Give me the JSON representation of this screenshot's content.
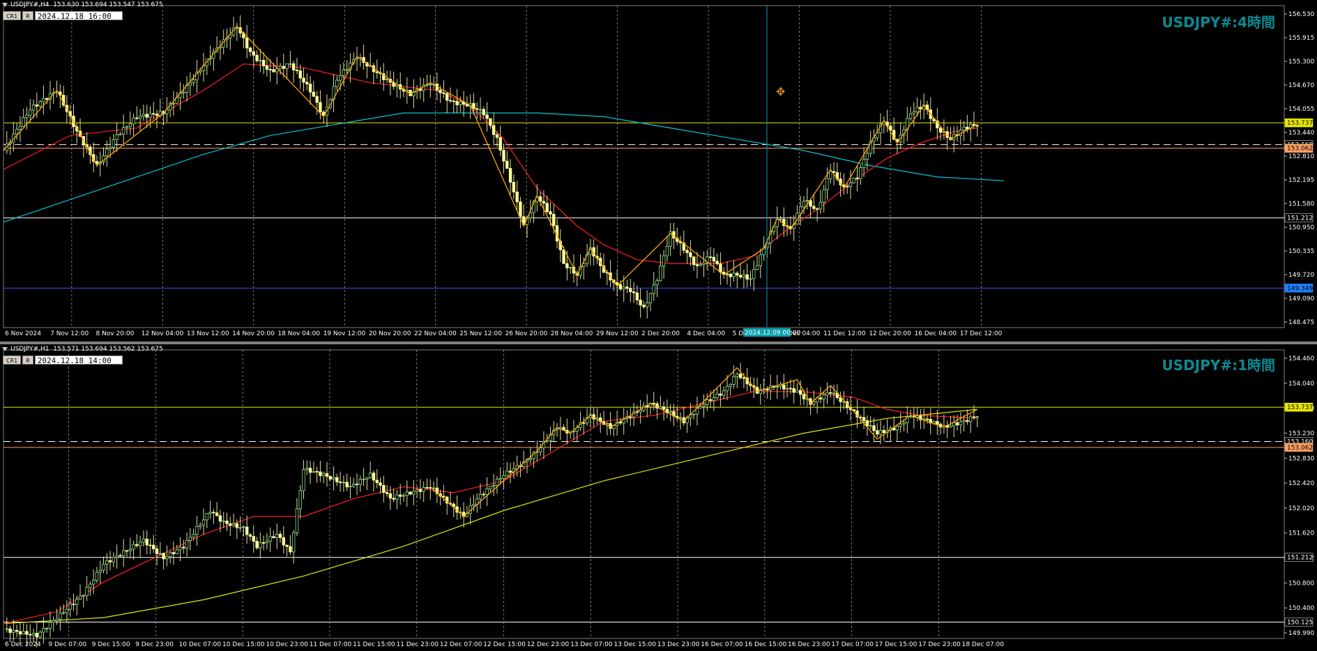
{
  "colors": {
    "bg": "#000000",
    "candle": "#ffff99",
    "zigzag": "#ffa500",
    "ma_red": "#ff2020",
    "ma_cyan": "#00c8d8",
    "ma_yellow": "#e8e800",
    "grid": "#c8c8c8",
    "hline_yellow": "#e8e800",
    "hline_white": "#ffffff",
    "hline_blue": "#3050ff",
    "vline_cursor": "#0aa0b0",
    "title": "#0a8a93"
  },
  "icons": {
    "panel_menu": "triangle-down-icon",
    "tool": "crosshair-tool-icon"
  },
  "chart_data": [
    {
      "type": "candlestick",
      "symbol": "USDJPY#,H4",
      "ohlc_header": "153.630 153.694 153.547 153.675",
      "buttons": [
        "CR1",
        "R"
      ],
      "time_box": "2024.12.18 16:00",
      "title": "USDJPY#:4時間",
      "ylim": [
        148.3,
        156.85
      ],
      "y_ticks": [
        "156.530",
        "155.915",
        "155.300",
        "154.670",
        "154.055",
        "153.440",
        "152.810",
        "152.195",
        "151.580",
        "150.950",
        "150.335",
        "149.720",
        "149.090",
        "148.475"
      ],
      "x_ticks": [
        "6 Nov 2024",
        "7 Nov 12:00",
        "8 Nov 20:00",
        "12 Nov 04:00",
        "13 Nov 12:00",
        "14 Nov 20:00",
        "18 Nov 04:00",
        "19 Nov 12:00",
        "20 Nov 20:00",
        "22 Nov 04:00",
        "25 Nov 12:00",
        "26 Nov 20:00",
        "28 Nov 04:00",
        "29 Nov 12:00",
        "2 Dec 20:00",
        "4 Dec 04:00",
        "5 Dec 1",
        "10 Dec 04:00",
        "11 Dec 12:00",
        "12 Dec 20:00",
        "16 Dec 04:00",
        "17 Dec 12:00"
      ],
      "cursor_label": "2024.12.09 00:00",
      "hlines": [
        {
          "price": 153.737,
          "label": "153.737",
          "style": "solid",
          "color": "#e8e800"
        },
        {
          "price": 153.16,
          "label": "153.160",
          "style": "dashed",
          "color": "#ffffff"
        },
        {
          "price": 153.062,
          "label": "153.062",
          "style": "solid",
          "color": "#ffa060"
        },
        {
          "price": 151.212,
          "label": "151.212",
          "style": "solid",
          "color": "#ffffff"
        },
        {
          "price": 149.349,
          "label": "149.349",
          "style": "solid",
          "color": "#3050ff"
        }
      ],
      "close_path": [
        [
          0,
          153.0
        ],
        [
          8,
          154.1
        ],
        [
          16,
          154.6
        ],
        [
          22,
          153.5
        ],
        [
          28,
          152.6
        ],
        [
          34,
          153.4
        ],
        [
          40,
          153.9
        ],
        [
          48,
          154.0
        ],
        [
          56,
          154.8
        ],
        [
          62,
          155.5
        ],
        [
          70,
          156.3
        ],
        [
          74,
          155.6
        ],
        [
          80,
          155.1
        ],
        [
          86,
          155.3
        ],
        [
          92,
          154.6
        ],
        [
          96,
          153.9
        ],
        [
          100,
          154.9
        ],
        [
          106,
          155.5
        ],
        [
          110,
          155.2
        ],
        [
          116,
          154.8
        ],
        [
          122,
          154.5
        ],
        [
          128,
          154.8
        ],
        [
          134,
          154.3
        ],
        [
          140,
          154.2
        ],
        [
          144,
          154.0
        ],
        [
          148,
          153.3
        ],
        [
          152,
          152.2
        ],
        [
          156,
          151.0
        ],
        [
          160,
          151.8
        ],
        [
          164,
          151.3
        ],
        [
          168,
          150.0
        ],
        [
          172,
          149.7
        ],
        [
          176,
          150.4
        ],
        [
          180,
          149.8
        ],
        [
          184,
          149.4
        ],
        [
          188,
          149.3
        ],
        [
          192,
          148.8
        ],
        [
          196,
          149.6
        ],
        [
          200,
          150.8
        ],
        [
          204,
          150.4
        ],
        [
          208,
          149.9
        ],
        [
          212,
          150.2
        ],
        [
          216,
          149.7
        ],
        [
          220,
          149.7
        ],
        [
          224,
          149.6
        ],
        [
          228,
          150.4
        ],
        [
          232,
          151.2
        ],
        [
          236,
          150.9
        ],
        [
          240,
          151.7
        ],
        [
          244,
          151.4
        ],
        [
          248,
          152.5
        ],
        [
          252,
          152.0
        ],
        [
          256,
          152.3
        ],
        [
          260,
          153.2
        ],
        [
          264,
          153.8
        ],
        [
          268,
          153.2
        ],
        [
          272,
          154.0
        ],
        [
          276,
          154.2
        ],
        [
          280,
          153.6
        ],
        [
          284,
          153.3
        ],
        [
          288,
          153.6
        ],
        [
          292,
          153.7
        ]
      ],
      "zigzag": [
        [
          0,
          153.0
        ],
        [
          16,
          154.6
        ],
        [
          28,
          152.6
        ],
        [
          48,
          154.0
        ],
        [
          70,
          156.3
        ],
        [
          96,
          153.9
        ],
        [
          106,
          155.5
        ],
        [
          122,
          154.5
        ],
        [
          128,
          154.8
        ],
        [
          140,
          154.2
        ],
        [
          156,
          151.0
        ],
        [
          160,
          151.8
        ],
        [
          172,
          149.7
        ],
        [
          176,
          150.4
        ],
        [
          184,
          149.4
        ],
        [
          200,
          150.8
        ],
        [
          216,
          149.7
        ],
        [
          228,
          150.4
        ],
        [
          232,
          151.2
        ],
        [
          236,
          150.9
        ],
        [
          248,
          152.5
        ],
        [
          252,
          152.0
        ],
        [
          264,
          153.8
        ],
        [
          268,
          153.2
        ],
        [
          276,
          154.2
        ],
        [
          284,
          153.3
        ],
        [
          292,
          153.7
        ]
      ],
      "ma_red": [
        [
          0,
          152.5
        ],
        [
          20,
          153.4
        ],
        [
          40,
          153.6
        ],
        [
          60,
          154.6
        ],
        [
          72,
          155.3
        ],
        [
          90,
          155.2
        ],
        [
          110,
          154.8
        ],
        [
          130,
          154.6
        ],
        [
          140,
          154.2
        ],
        [
          150,
          153.3
        ],
        [
          160,
          152.0
        ],
        [
          172,
          151.0
        ],
        [
          180,
          150.5
        ],
        [
          190,
          150.1
        ],
        [
          200,
          150.0
        ],
        [
          215,
          150.0
        ],
        [
          225,
          150.2
        ],
        [
          235,
          150.9
        ],
        [
          245,
          151.5
        ],
        [
          255,
          152.2
        ],
        [
          265,
          152.8
        ],
        [
          275,
          153.2
        ],
        [
          285,
          153.5
        ],
        [
          292,
          153.6
        ]
      ],
      "ma_cyan": [
        [
          0,
          151.1
        ],
        [
          30,
          152.0
        ],
        [
          60,
          152.9
        ],
        [
          80,
          153.4
        ],
        [
          100,
          153.7
        ],
        [
          120,
          154.0
        ],
        [
          140,
          154.0
        ],
        [
          160,
          154.0
        ],
        [
          180,
          153.9
        ],
        [
          200,
          153.6
        ],
        [
          220,
          153.3
        ],
        [
          240,
          153.0
        ],
        [
          260,
          152.6
        ],
        [
          280,
          152.3
        ],
        [
          300,
          152.2
        ]
      ]
    },
    {
      "type": "candlestick",
      "symbol": "USDJPY#,H1",
      "ohlc_header": "153.571 153.694 153.562 153.675",
      "buttons": [
        "CR1",
        "R"
      ],
      "time_box": "2024.12.18 14:00",
      "title": "USDJPY#:1時間",
      "ylim": [
        149.85,
        154.7
      ],
      "y_ticks": [
        "154.460",
        "154.040",
        "153.630",
        "153.230",
        "152.830",
        "152.420",
        "152.020",
        "151.620",
        "151.212",
        "150.800",
        "150.400",
        "149.990"
      ],
      "x_ticks": [
        "6 Dec 2024",
        "9 Dec 07:00",
        "9 Dec 15:00",
        "9 Dec 23:00",
        "10 Dec 07:00",
        "10 Dec 15:00",
        "10 Dec 23:00",
        "11 Dec 07:00",
        "11 Dec 15:00",
        "11 Dec 23:00",
        "12 Dec 07:00",
        "12 Dec 15:00",
        "12 Dec 23:00",
        "13 Dec 07:00",
        "13 Dec 15:00",
        "13 Dec 23:00",
        "16 Dec 07:00",
        "16 Dec 15:00",
        "16 Dec 23:00",
        "17 Dec 07:00",
        "17 Dec 15:00",
        "17 Dec 23:00",
        "18 Dec 07:00"
      ],
      "hlines": [
        {
          "price": 153.737,
          "label": "153.737",
          "style": "solid",
          "color": "#e8e800"
        },
        {
          "price": 153.16,
          "label": "153.160",
          "style": "dashed",
          "color": "#ffffff"
        },
        {
          "price": 153.062,
          "label": "153.062",
          "style": "solid",
          "color": "#ffa060"
        },
        {
          "price": 151.212,
          "label": "151.212",
          "style": "solid",
          "color": "#ffffff"
        },
        {
          "price": 150.125,
          "label": "150.125",
          "style": "solid",
          "color": "#ffffff"
        }
      ],
      "close_path": [
        [
          0,
          150.0
        ],
        [
          10,
          149.9
        ],
        [
          16,
          150.2
        ],
        [
          24,
          150.6
        ],
        [
          30,
          151.1
        ],
        [
          36,
          151.3
        ],
        [
          42,
          151.5
        ],
        [
          48,
          151.2
        ],
        [
          54,
          151.4
        ],
        [
          58,
          151.7
        ],
        [
          62,
          152.0
        ],
        [
          66,
          151.8
        ],
        [
          72,
          151.7
        ],
        [
          76,
          151.4
        ],
        [
          82,
          151.6
        ],
        [
          86,
          151.3
        ],
        [
          90,
          152.7
        ],
        [
          96,
          152.6
        ],
        [
          104,
          152.4
        ],
        [
          110,
          152.6
        ],
        [
          116,
          152.2
        ],
        [
          122,
          152.3
        ],
        [
          128,
          152.4
        ],
        [
          132,
          152.2
        ],
        [
          138,
          151.9
        ],
        [
          142,
          152.2
        ],
        [
          146,
          152.4
        ],
        [
          150,
          152.6
        ],
        [
          156,
          152.8
        ],
        [
          160,
          153.0
        ],
        [
          166,
          153.4
        ],
        [
          170,
          153.3
        ],
        [
          176,
          153.6
        ],
        [
          182,
          153.4
        ],
        [
          188,
          153.6
        ],
        [
          194,
          153.8
        ],
        [
          198,
          153.7
        ],
        [
          204,
          153.5
        ],
        [
          210,
          153.8
        ],
        [
          216,
          154.0
        ],
        [
          220,
          154.3
        ],
        [
          226,
          154.0
        ],
        [
          232,
          154.1
        ],
        [
          238,
          154.0
        ],
        [
          242,
          153.8
        ],
        [
          248,
          154.0
        ],
        [
          254,
          153.7
        ],
        [
          258,
          153.5
        ],
        [
          262,
          153.3
        ],
        [
          268,
          153.4
        ],
        [
          272,
          153.6
        ],
        [
          278,
          153.5
        ],
        [
          282,
          153.4
        ],
        [
          288,
          153.5
        ],
        [
          292,
          153.6
        ]
      ],
      "zigzag": [
        [
          128,
          152.4
        ],
        [
          138,
          151.9
        ],
        [
          160,
          153.0
        ],
        [
          166,
          153.4
        ],
        [
          170,
          153.3
        ],
        [
          176,
          153.6
        ],
        [
          182,
          153.4
        ],
        [
          194,
          153.8
        ],
        [
          204,
          153.5
        ],
        [
          220,
          154.4
        ],
        [
          226,
          154.0
        ],
        [
          238,
          154.2
        ],
        [
          242,
          153.8
        ],
        [
          248,
          154.1
        ],
        [
          256,
          153.6
        ],
        [
          262,
          153.2
        ],
        [
          272,
          153.6
        ],
        [
          282,
          153.4
        ],
        [
          292,
          153.7
        ]
      ],
      "ma_red": [
        [
          0,
          150.1
        ],
        [
          16,
          150.3
        ],
        [
          30,
          150.8
        ],
        [
          45,
          151.2
        ],
        [
          60,
          151.6
        ],
        [
          75,
          151.9
        ],
        [
          90,
          151.9
        ],
        [
          105,
          152.2
        ],
        [
          120,
          152.4
        ],
        [
          135,
          152.3
        ],
        [
          150,
          152.5
        ],
        [
          165,
          153.0
        ],
        [
          180,
          153.5
        ],
        [
          195,
          153.6
        ],
        [
          210,
          153.8
        ],
        [
          225,
          154.0
        ],
        [
          240,
          154.0
        ],
        [
          255,
          153.9
        ],
        [
          265,
          153.7
        ],
        [
          275,
          153.6
        ],
        [
          292,
          153.55
        ]
      ],
      "ma_yellow": [
        [
          0,
          150.1
        ],
        [
          30,
          150.2
        ],
        [
          60,
          150.5
        ],
        [
          90,
          150.9
        ],
        [
          120,
          151.4
        ],
        [
          150,
          152.0
        ],
        [
          180,
          152.5
        ],
        [
          210,
          152.9
        ],
        [
          240,
          153.3
        ],
        [
          265,
          153.55
        ],
        [
          292,
          153.7
        ]
      ]
    }
  ]
}
